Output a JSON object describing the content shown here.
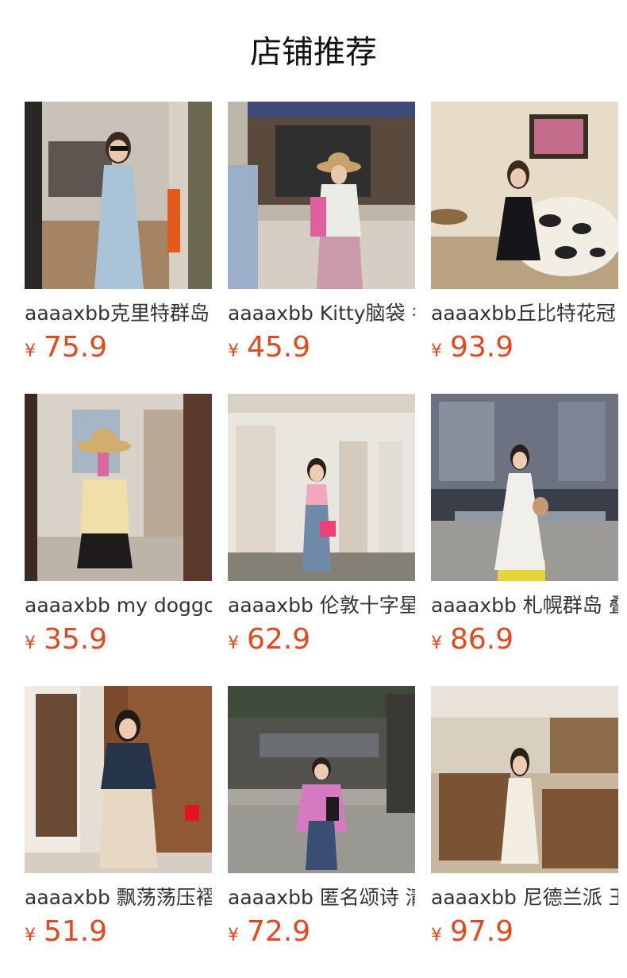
{
  "page": {
    "title": "店铺推荐"
  },
  "products": [
    {
      "name": "aaaaxbb克里特群岛",
      "currency": "¥",
      "price": "75.9",
      "image": "woman-mirror-selfie-blue-dress"
    },
    {
      "name": "aaaaxbb Kitty脑袋 名",
      "currency": "¥",
      "price": "45.9",
      "image": "woman-straw-hat-holding-hands"
    },
    {
      "name": "aaaaxbb丘比特花冠",
      "currency": "¥",
      "price": "93.9",
      "image": "woman-black-dress-floral-sofa"
    },
    {
      "name": "aaaaxbb my doggo",
      "currency": "¥",
      "price": "35.9",
      "image": "woman-straw-hat-mirror-selfie"
    },
    {
      "name": "aaaaxbb 伦敦十字星",
      "currency": "¥",
      "price": "62.9",
      "image": "woman-pink-top-jeans-hallway"
    },
    {
      "name": "aaaaxbb 札幌群岛 叠",
      "currency": "¥",
      "price": "86.9",
      "image": "woman-white-lace-dress-bench"
    },
    {
      "name": "aaaaxbb 飘荡荡压褶",
      "currency": "¥",
      "price": "51.9",
      "image": "woman-denim-jacket-floral-skirt"
    },
    {
      "name": "aaaaxbb 匿名颂诗 清",
      "currency": "¥",
      "price": "72.9",
      "image": "woman-pink-jacket-street"
    },
    {
      "name": "aaaaxbb 尼德兰派 王",
      "currency": "¥",
      "price": "97.9",
      "image": "woman-cream-dress-shop"
    }
  ],
  "colors": {
    "price": "#e8471c",
    "text": "#333333"
  }
}
